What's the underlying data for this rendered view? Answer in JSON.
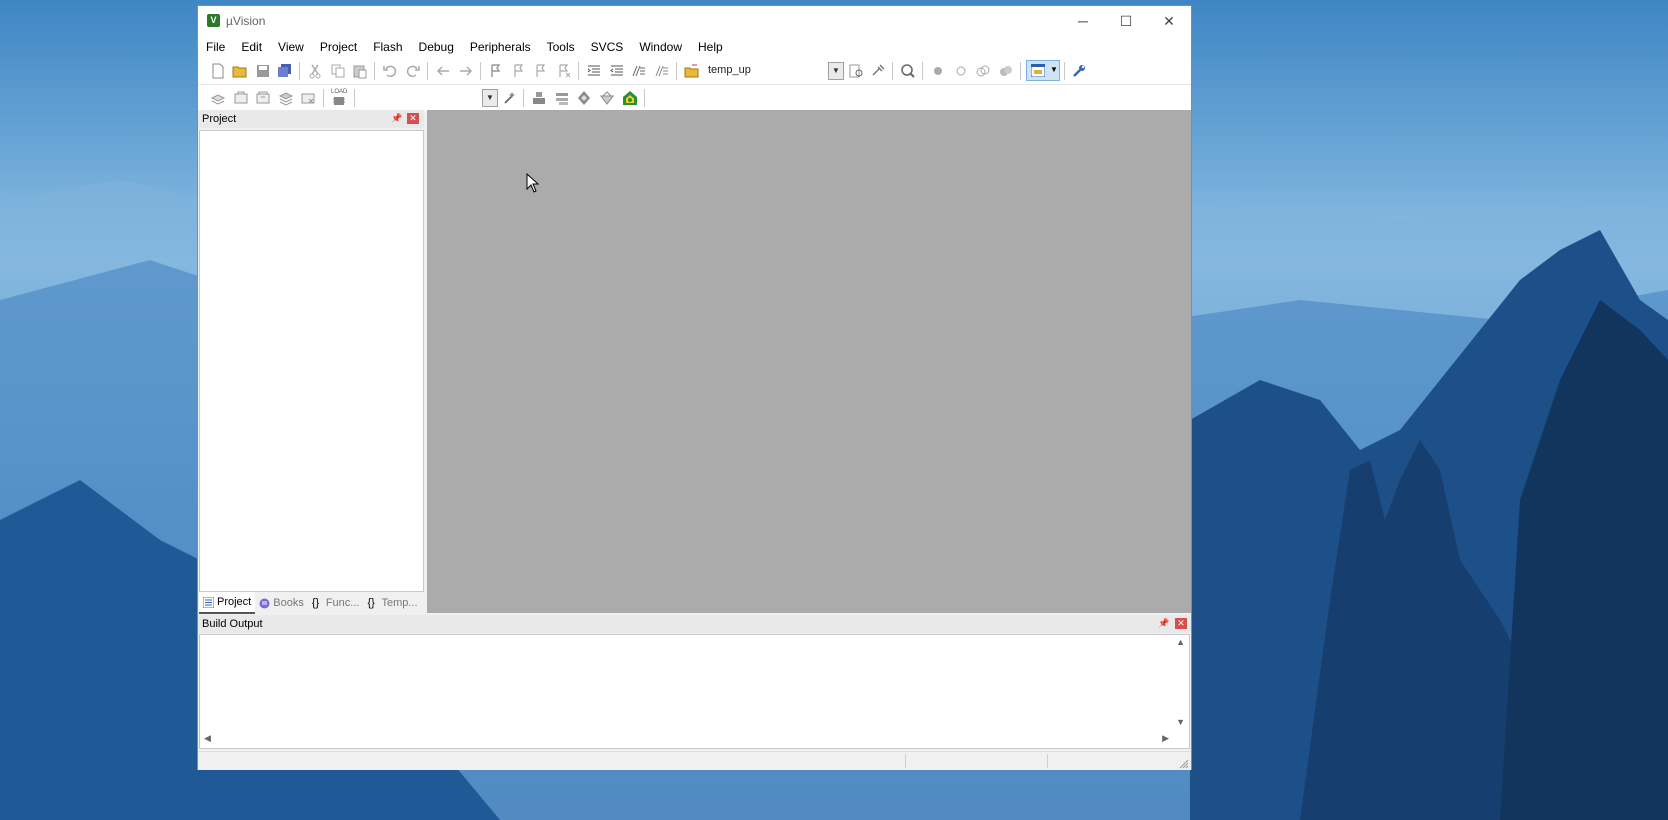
{
  "window": {
    "title": "µVision",
    "controls": {
      "minimize": "─",
      "maximize": "☐",
      "close": "✕"
    }
  },
  "menu": [
    "File",
    "Edit",
    "View",
    "Project",
    "Flash",
    "Debug",
    "Peripherals",
    "Tools",
    "SVCS",
    "Window",
    "Help"
  ],
  "toolbar": {
    "target_name": "temp_up",
    "load_label": "LOAD"
  },
  "project_panel": {
    "title": "Project",
    "tabs": [
      {
        "label": "Project",
        "icon": "project-tab-icon",
        "active": true
      },
      {
        "label": "Books",
        "icon": "books-tab-icon"
      },
      {
        "label": "Func...",
        "icon": "functions-tab-icon"
      },
      {
        "label": "Temp...",
        "icon": "templates-tab-icon"
      }
    ]
  },
  "build_output": {
    "title": "Build Output"
  },
  "colors": {
    "editor_bg": "#ababab",
    "close_btn": "#d64f4f",
    "desktop_sky": "#6aa6d6"
  }
}
